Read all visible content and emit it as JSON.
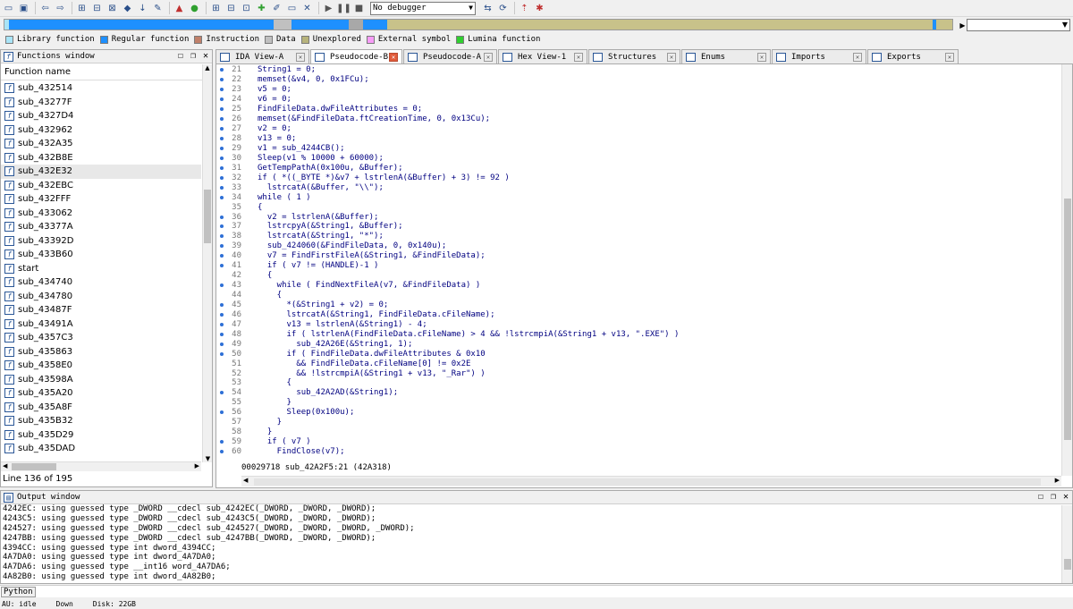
{
  "toolbar": {
    "debugger": "No debugger"
  },
  "legend": [
    {
      "label": "Library function",
      "color": "#a9e4f7"
    },
    {
      "label": "Regular function",
      "color": "#1e90ff"
    },
    {
      "label": "Instruction",
      "color": "#c0806a"
    },
    {
      "label": "Data",
      "color": "#c0c0c0"
    },
    {
      "label": "Unexplored",
      "color": "#b7b37c"
    },
    {
      "label": "External symbol",
      "color": "#f79cf7"
    },
    {
      "label": "Lumina function",
      "color": "#2fcf2f"
    }
  ],
  "functions_window": {
    "title": "Functions window",
    "column": "Function name",
    "items": [
      "sub_432514",
      "sub_43277F",
      "sub_4327D4",
      "sub_432962",
      "sub_432A35",
      "sub_432B8E",
      "sub_432E32",
      "sub_432EBC",
      "sub_432FFF",
      "sub_433062",
      "sub_43377A",
      "sub_43392D",
      "sub_433B60",
      "start",
      "sub_434740",
      "sub_434780",
      "sub_43487F",
      "sub_43491A",
      "sub_4357C3",
      "sub_435863",
      "sub_4358E0",
      "sub_43598A",
      "sub_435A20",
      "sub_435A8F",
      "sub_435B32",
      "sub_435D29",
      "sub_435DAD"
    ],
    "selected_index": 6,
    "status": "Line 136 of 195"
  },
  "tabs": [
    {
      "label": "IDA View-A",
      "active": false
    },
    {
      "label": "Pseudocode-B",
      "active": true
    },
    {
      "label": "Pseudocode-A",
      "active": false
    },
    {
      "label": "Hex View-1",
      "active": false
    },
    {
      "label": "Structures",
      "active": false
    },
    {
      "label": "Enums",
      "active": false
    },
    {
      "label": "Imports",
      "active": false
    },
    {
      "label": "Exports",
      "active": false
    }
  ],
  "pseudocode": {
    "lines": [
      {
        "n": "21",
        "dot": true,
        "text": "String1 = 0;"
      },
      {
        "n": "22",
        "dot": true,
        "text": "memset(&v4, 0, 0x1FCu);"
      },
      {
        "n": "23",
        "dot": true,
        "text": "v5 = 0;"
      },
      {
        "n": "24",
        "dot": true,
        "text": "v6 = 0;"
      },
      {
        "n": "25",
        "dot": true,
        "text": "FindFileData.dwFileAttributes = 0;"
      },
      {
        "n": "26",
        "dot": true,
        "text": "memset(&FindFileData.ftCreationTime, 0, 0x13Cu);"
      },
      {
        "n": "27",
        "dot": true,
        "text": "v2 = 0;"
      },
      {
        "n": "28",
        "dot": true,
        "text": "v13 = 0;"
      },
      {
        "n": "29",
        "dot": true,
        "text": "v1 = sub_4244CB();"
      },
      {
        "n": "30",
        "dot": true,
        "text": "Sleep(v1 % 10000 + 60000);"
      },
      {
        "n": "31",
        "dot": true,
        "text": "GetTempPathA(0x100u, &Buffer);"
      },
      {
        "n": "32",
        "dot": true,
        "text": "if ( *((_BYTE *)&v7 + lstrlenA(&Buffer) + 3) != 92 )"
      },
      {
        "n": "33",
        "dot": true,
        "text": "  lstrcatA(&Buffer, \"\\\\\");"
      },
      {
        "n": "34",
        "dot": true,
        "text": "while ( 1 )"
      },
      {
        "n": "35",
        "dot": false,
        "text": "{"
      },
      {
        "n": "36",
        "dot": true,
        "text": "  v2 = lstrlenA(&Buffer);"
      },
      {
        "n": "37",
        "dot": true,
        "text": "  lstrcpyA(&String1, &Buffer);"
      },
      {
        "n": "38",
        "dot": true,
        "text": "  lstrcatA(&String1, \"*\");"
      },
      {
        "n": "39",
        "dot": true,
        "text": "  sub_424060(&FindFileData, 0, 0x140u);"
      },
      {
        "n": "40",
        "dot": true,
        "text": "  v7 = FindFirstFileA(&String1, &FindFileData);"
      },
      {
        "n": "41",
        "dot": true,
        "text": "  if ( v7 != (HANDLE)-1 )"
      },
      {
        "n": "42",
        "dot": false,
        "text": "  {"
      },
      {
        "n": "43",
        "dot": true,
        "text": "    while ( FindNextFileA(v7, &FindFileData) )"
      },
      {
        "n": "44",
        "dot": false,
        "text": "    {"
      },
      {
        "n": "45",
        "dot": true,
        "text": "      *(&String1 + v2) = 0;"
      },
      {
        "n": "46",
        "dot": true,
        "text": "      lstrcatA(&String1, FindFileData.cFileName);"
      },
      {
        "n": "47",
        "dot": true,
        "text": "      v13 = lstrlenA(&String1) - 4;"
      },
      {
        "n": "48",
        "dot": true,
        "text": "      if ( lstrlenA(FindFileData.cFileName) > 4 && !lstrcmpiA(&String1 + v13, \".EXE\") )"
      },
      {
        "n": "49",
        "dot": true,
        "text": "        sub_42A26E(&String1, 1);"
      },
      {
        "n": "50",
        "dot": true,
        "text": "      if ( FindFileData.dwFileAttributes & 0x10"
      },
      {
        "n": "51",
        "dot": false,
        "text": "        && FindFileData.cFileName[0] != 0x2E"
      },
      {
        "n": "52",
        "dot": false,
        "text": "        && !lstrcmpiA(&String1 + v13, \"_Rar\") )"
      },
      {
        "n": "53",
        "dot": false,
        "text": "      {"
      },
      {
        "n": "54",
        "dot": true,
        "text": "        sub_42A2AD(&String1);"
      },
      {
        "n": "55",
        "dot": false,
        "text": "      }"
      },
      {
        "n": "56",
        "dot": true,
        "text": "      Sleep(0x100u);"
      },
      {
        "n": "57",
        "dot": false,
        "text": "    }"
      },
      {
        "n": "58",
        "dot": false,
        "text": "  }"
      },
      {
        "n": "59",
        "dot": true,
        "text": "  if ( v7 )"
      },
      {
        "n": "60",
        "dot": true,
        "text": "    FindClose(v7);"
      }
    ],
    "status": "00029718 sub_42A2F5:21 (42A318)"
  },
  "output_window": {
    "title": "Output window",
    "lines": [
      "4242EC: using guessed type _DWORD __cdecl sub_4242EC(_DWORD, _DWORD, _DWORD);",
      "4243C5: using guessed type _DWORD __cdecl sub_4243C5(_DWORD, _DWORD, _DWORD);",
      "424527: using guessed type _DWORD __cdecl sub_424527(_DWORD, _DWORD, _DWORD, _DWORD);",
      "4247BB: using guessed type _DWORD __cdecl sub_4247BB(_DWORD, _DWORD, _DWORD);",
      "4394CC: using guessed type int dword_4394CC;",
      "4A7DA0: using guessed type int dword_4A7DA0;",
      "4A7DA6: using guessed type __int16 word_4A7DA6;",
      "4A82B0: using guessed type int dword_4A82B0;"
    ]
  },
  "python_label": "Python",
  "statusbar": {
    "au": "AU:  idle",
    "dir": "Down",
    "disk": "Disk: 22GB"
  }
}
